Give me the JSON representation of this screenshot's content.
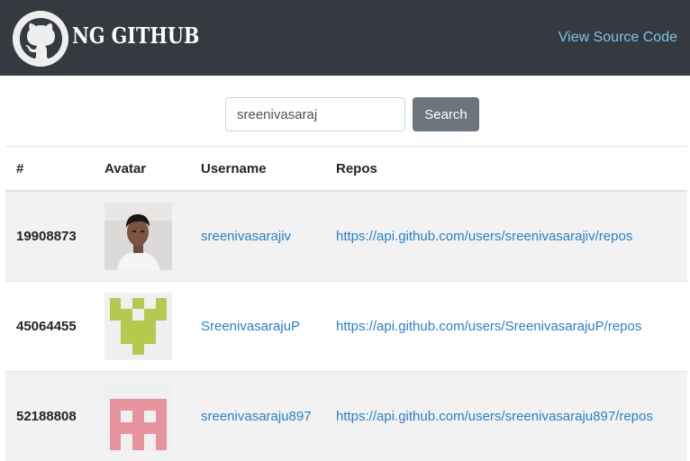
{
  "header": {
    "brand": "NG GITHUB",
    "source_link": "View Source Code",
    "logo_icon": "github-octocat-icon"
  },
  "search": {
    "value": "sreenivasaraj",
    "button_label": "Search"
  },
  "table": {
    "columns": [
      "#",
      "Avatar",
      "Username",
      "Repos"
    ],
    "rows": [
      {
        "id": "19908873",
        "username": "sreenivasarajiv",
        "repos": "https://api.github.com/users/sreenivasarajiv/repos",
        "avatar": "photo-avatar"
      },
      {
        "id": "45064455",
        "username": "SreenivasarajuP",
        "repos": "https://api.github.com/users/SreenivasarajuP/repos",
        "avatar": "identicon-green"
      },
      {
        "id": "52188808",
        "username": "sreenivasaraju897",
        "repos": "https://api.github.com/users/sreenivasaraju897/repos",
        "avatar": "identicon-pink"
      }
    ]
  },
  "colors": {
    "navbar": "#343a40",
    "link": "#2b7fc9",
    "button": "#6c757d",
    "identicon_green": "#b5c94f",
    "identicon_pink": "#e7939e"
  }
}
